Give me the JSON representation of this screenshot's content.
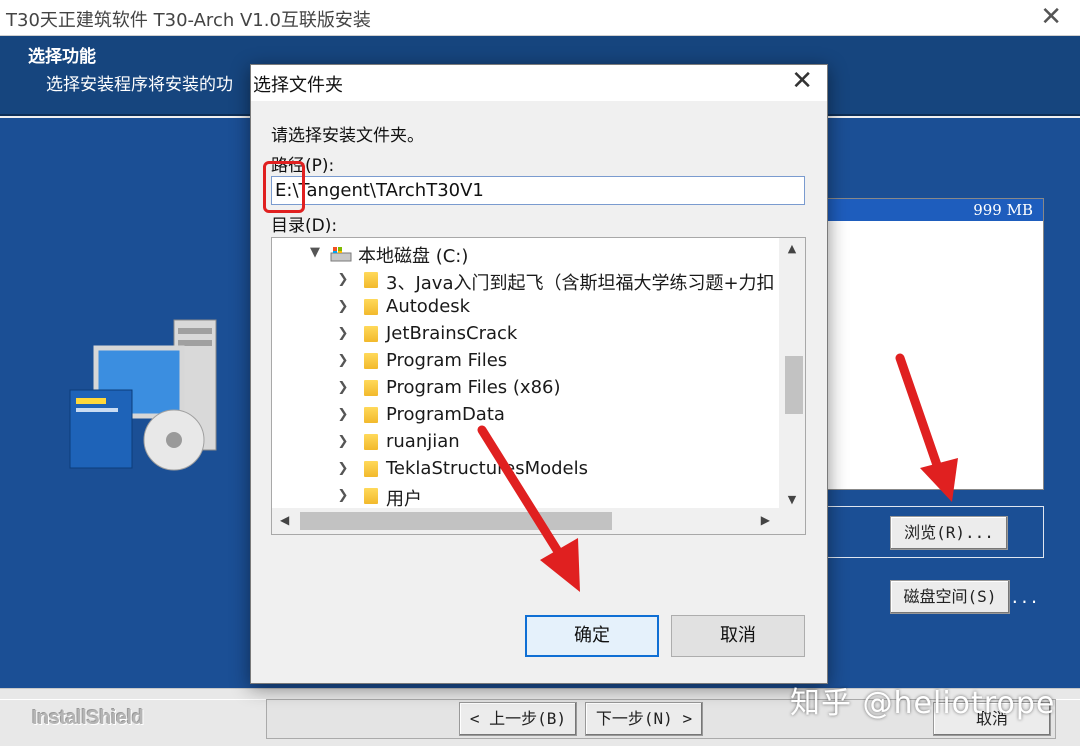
{
  "installer": {
    "title": "T30天正建筑软件 T30-Arch V1.0互联版安装",
    "header_title": "选择功能",
    "header_subtitle": "选择安装程序将安装的功",
    "size_value": "999 MB",
    "browse_label": "浏览(R)...",
    "disk_space_label": "磁盘空间(S)",
    "disk_space_suffix": "...",
    "brand": "InstallShield",
    "prev_label": "< 上一步(B)",
    "next_label": "下一步(N) >",
    "cancel_label": "取消"
  },
  "dialog": {
    "title": "选择文件夹",
    "instruction": "请选择安装文件夹。",
    "path_label": "路径(P):",
    "path_value": "E:\\Tangent\\TArchT30V1",
    "dir_label": "目录(D):",
    "tree": [
      {
        "label": "本地磁盘 (C:)",
        "expanded": true
      },
      {
        "label": "3、Java入门到起飞（含斯坦福大学练习题+力扣"
      },
      {
        "label": "Autodesk"
      },
      {
        "label": "JetBrainsCrack"
      },
      {
        "label": "Program Files"
      },
      {
        "label": "Program Files (x86)"
      },
      {
        "label": "ProgramData"
      },
      {
        "label": "ruanjian"
      },
      {
        "label": "TeklaStructuresModels"
      },
      {
        "label": "用户"
      }
    ],
    "ok_label": "确定",
    "cancel_label": "取消"
  },
  "watermark": "知乎 @heliotrope",
  "colors": {
    "header_blue": "#16457e",
    "body_blue": "#1b4f95",
    "annotation_red": "#e02020",
    "selection_blue": "#1e5dbd"
  }
}
